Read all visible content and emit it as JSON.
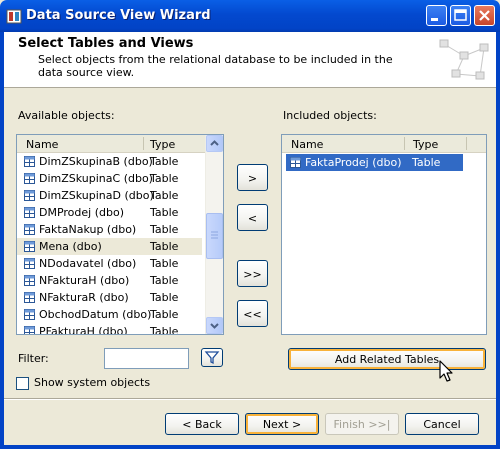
{
  "window": {
    "title": "Data Source View Wizard",
    "buttons": {
      "minimize": "minimize-icon",
      "maximize": "maximize-icon",
      "close": "close-icon"
    }
  },
  "header": {
    "title": "Select Tables and Views",
    "description": "Select objects from the relational database to be included in the data source view."
  },
  "available": {
    "label": "Available objects:",
    "columns": {
      "name": "Name",
      "type": "Type"
    },
    "rows": [
      {
        "name": "DimZSkupinaB (dbo)",
        "type": "Table"
      },
      {
        "name": "DimZSkupinaC (dbo)",
        "type": "Table"
      },
      {
        "name": "DimZSkupinaD (dbo)",
        "type": "Table"
      },
      {
        "name": "DMProdej (dbo)",
        "type": "Table"
      },
      {
        "name": "FaktaNakup (dbo)",
        "type": "Table"
      },
      {
        "name": "Mena (dbo)",
        "type": "Table"
      },
      {
        "name": "NDodavatel (dbo)",
        "type": "Table"
      },
      {
        "name": "NFakturaH (dbo)",
        "type": "Table"
      },
      {
        "name": "NFakturaR (dbo)",
        "type": "Table"
      },
      {
        "name": "ObchodDatum (dbo)",
        "type": "Table"
      },
      {
        "name": "PFakturaH (dbo)",
        "type": "Table"
      }
    ],
    "selected_index": 5
  },
  "transfer_buttons": {
    "add": ">",
    "remove": "<",
    "add_all": ">>",
    "remove_all": "<<"
  },
  "included": {
    "label": "Included objects:",
    "columns": {
      "name": "Name",
      "type": "Type"
    },
    "rows": [
      {
        "name": "FaktaProdej (dbo)",
        "type": "Table"
      }
    ]
  },
  "filter": {
    "label": "Filter:",
    "value": ""
  },
  "add_related_label": "Add Related Tables",
  "show_system_label": "Show system objects",
  "footer": {
    "back": "< Back",
    "next": "Next >",
    "finish": "Finish >>|",
    "cancel": "Cancel"
  },
  "colors": {
    "titlebar": "#0243C6",
    "selection": "#316AC5",
    "dialog": "#ECE9D8"
  }
}
